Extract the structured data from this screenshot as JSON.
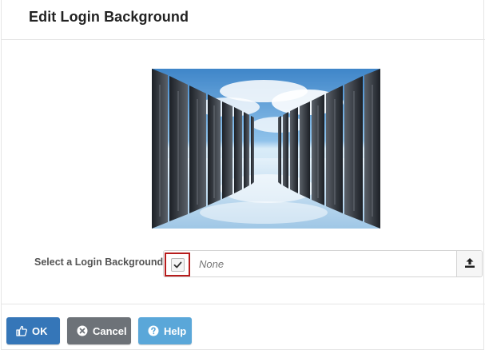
{
  "dialog": {
    "title": "Edit Login Background"
  },
  "form": {
    "label": "Select a Login Background",
    "value": "None"
  },
  "buttons": {
    "ok": "OK",
    "cancel": "Cancel",
    "help": "Help"
  },
  "icons": {
    "checkbox": "check-icon",
    "upload": "upload-icon",
    "ok": "thumbs-up-icon",
    "cancel": "times-circle-icon",
    "help": "question-circle-icon"
  },
  "colors": {
    "ok": "#3576b8",
    "cancel": "#6d7278",
    "help": "#5aa7d9",
    "highlight": "#b71c1c"
  }
}
